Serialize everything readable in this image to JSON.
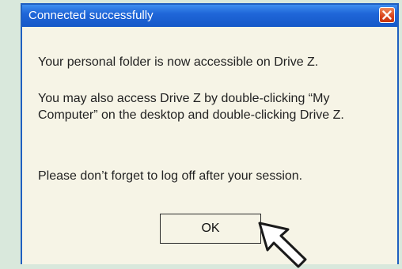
{
  "window": {
    "title": "Connected successfully"
  },
  "message": {
    "line1": "Your personal folder is now accessible on Drive Z.",
    "line2": "You may also access Drive Z by double-clicking “My Computer” on the desktop and double-clicking Drive Z.",
    "line3": "Please don’t forget to log off after your session."
  },
  "buttons": {
    "ok_label": "OK"
  },
  "icons": {
    "close": "close-icon",
    "cursor": "mouse-pointer-icon"
  },
  "colors": {
    "titlebar": "#1f66d8",
    "dialog_bg": "#f6f4e6",
    "close_button": "#d8421c",
    "backdrop": "#d9e8dc"
  }
}
